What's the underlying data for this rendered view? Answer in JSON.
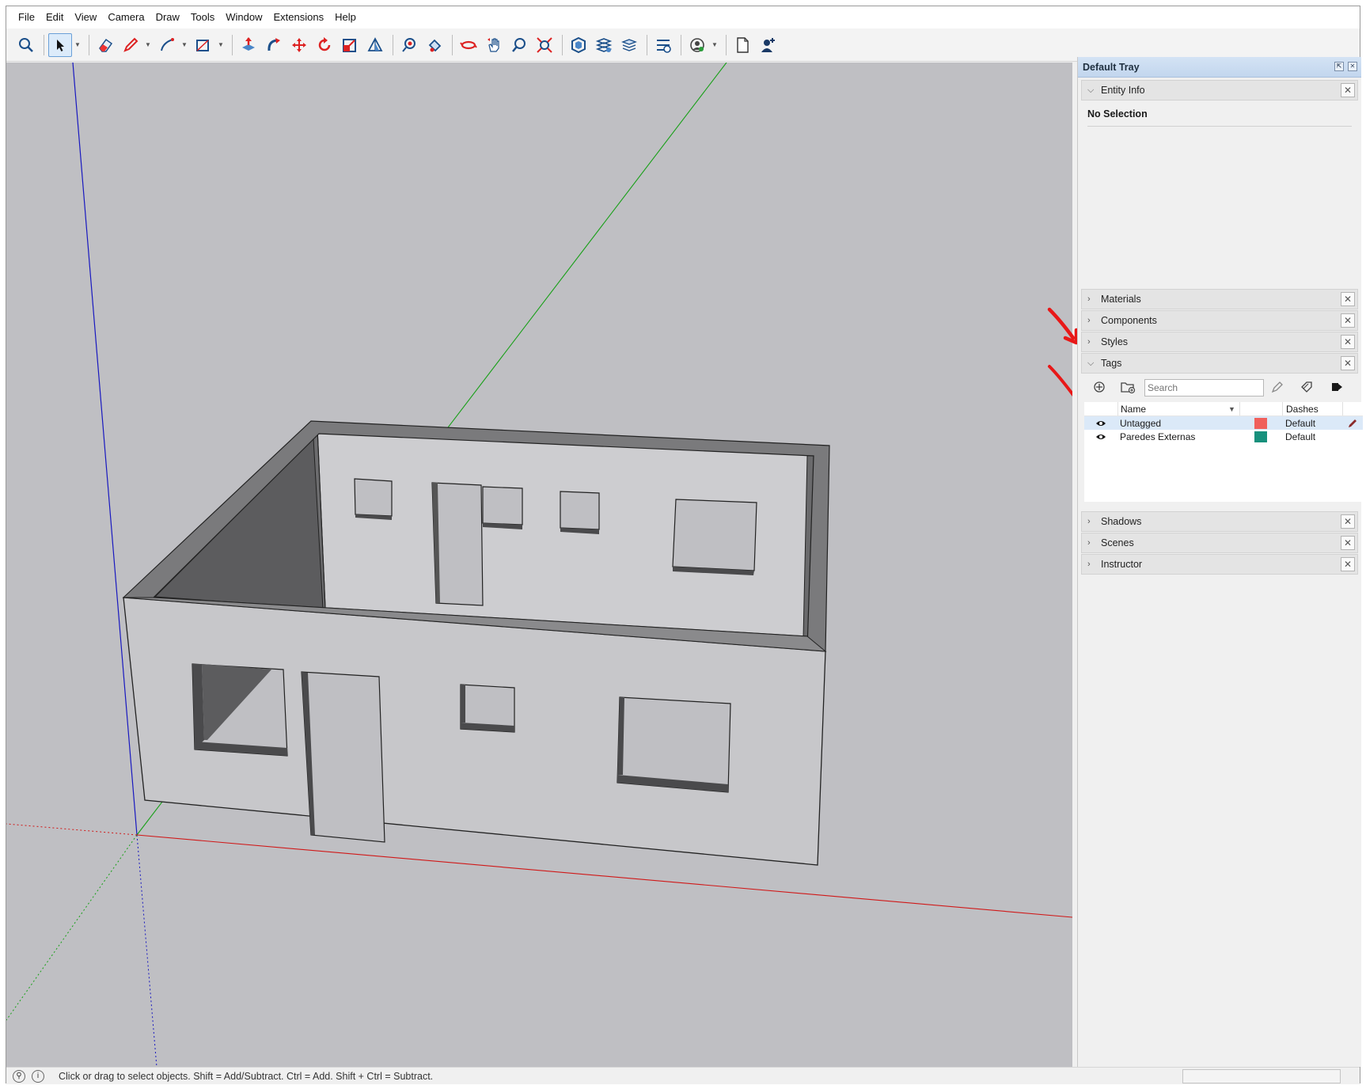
{
  "menu": [
    "File",
    "Edit",
    "View",
    "Camera",
    "Draw",
    "Tools",
    "Window",
    "Extensions",
    "Help"
  ],
  "toolbar": {
    "tools": [
      "search-icon",
      "select-icon",
      "eraser-icon",
      "pencil-icon",
      "line-icon",
      "rectangle-icon",
      "push-pull-icon",
      "follow-me-icon",
      "move-icon",
      "rotate-icon",
      "scale-icon",
      "section-plane-icon",
      "tape-measure-icon",
      "paint-bucket-icon",
      "orbit-icon",
      "pan-icon",
      "zoom-icon",
      "zoom-extents-icon",
      "warehouse-icon",
      "extension-warehouse-icon",
      "layers-icon",
      "extension-manager-icon",
      "account-icon",
      "new-file-icon",
      "user-add-icon"
    ]
  },
  "tray": {
    "title": "Default Tray",
    "entity_info": {
      "label": "Entity Info",
      "selection": "No Selection"
    },
    "panels_collapsed": [
      "Materials",
      "Components",
      "Styles"
    ],
    "tags": {
      "label": "Tags",
      "search_placeholder": "Search",
      "columns": {
        "name": "Name",
        "dashes": "Dashes"
      },
      "rows": [
        {
          "name": "Untagged",
          "color": "#f0605c",
          "dashes": "Default",
          "selected": true
        },
        {
          "name": "Paredes Externas",
          "color": "#17907c",
          "dashes": "Default",
          "selected": false
        }
      ]
    },
    "panels_bottom": [
      "Shadows",
      "Scenes",
      "Instructor"
    ]
  },
  "status": {
    "text": "Click or drag to select objects. Shift = Add/Subtract. Ctrl = Add. Shift + Ctrl = Subtract."
  },
  "colors": {
    "axis_red": "#d01818",
    "axis_green": "#18a018",
    "axis_blue": "#1818c0",
    "annotation_arrow": "#e81818",
    "viewport_bg": "#bfbfc3"
  }
}
